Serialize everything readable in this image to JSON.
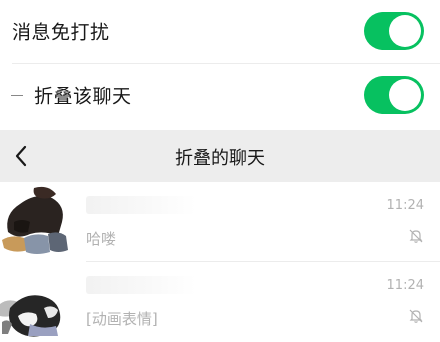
{
  "settings": {
    "mute_label": "消息免打扰",
    "mute_on": true,
    "fold_label": "折叠该聊天",
    "fold_on": true
  },
  "navbar": {
    "title": "折叠的聊天",
    "back_icon": "chevron-left-icon"
  },
  "chats": [
    {
      "name": "",
      "preview": "哈喽",
      "time": "11:24",
      "muted": true
    },
    {
      "name": "",
      "preview": "[动画表情]",
      "time": "11:24",
      "muted": true
    }
  ],
  "colors": {
    "toggle_on": "#07c160",
    "navbar_bg": "#ededed",
    "secondary_text": "#b2b2b2"
  }
}
